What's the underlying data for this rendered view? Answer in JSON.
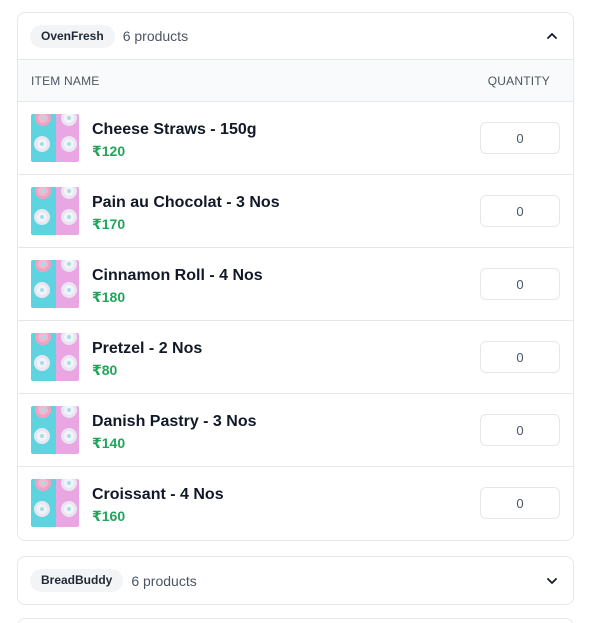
{
  "groups": [
    {
      "vendor": "OvenFresh",
      "count_text": "6 products",
      "expanded": true,
      "columns": {
        "item_name": "ITEM NAME",
        "quantity": "QUANTITY"
      },
      "items": [
        {
          "name": "Cheese Straws - 150g",
          "price": "₹120",
          "quantity": "0"
        },
        {
          "name": "Pain au Chocolat - 3 Nos",
          "price": "₹170",
          "quantity": "0"
        },
        {
          "name": "Cinnamon Roll - 4 Nos",
          "price": "₹180",
          "quantity": "0"
        },
        {
          "name": "Pretzel - 2 Nos",
          "price": "₹80",
          "quantity": "0"
        },
        {
          "name": "Danish Pastry - 3 Nos",
          "price": "₹140",
          "quantity": "0"
        },
        {
          "name": "Croissant - 4 Nos",
          "price": "₹160",
          "quantity": "0"
        }
      ]
    },
    {
      "vendor": "BreadBuddy",
      "count_text": "6 products",
      "expanded": false
    }
  ],
  "icons": {
    "collapse": "chevron-up-icon",
    "expand": "chevron-down-icon",
    "product_image": "donut-image"
  },
  "colors": {
    "price": "#22a55a",
    "border": "#e5e7eb",
    "header_bg": "#f9fafb"
  }
}
